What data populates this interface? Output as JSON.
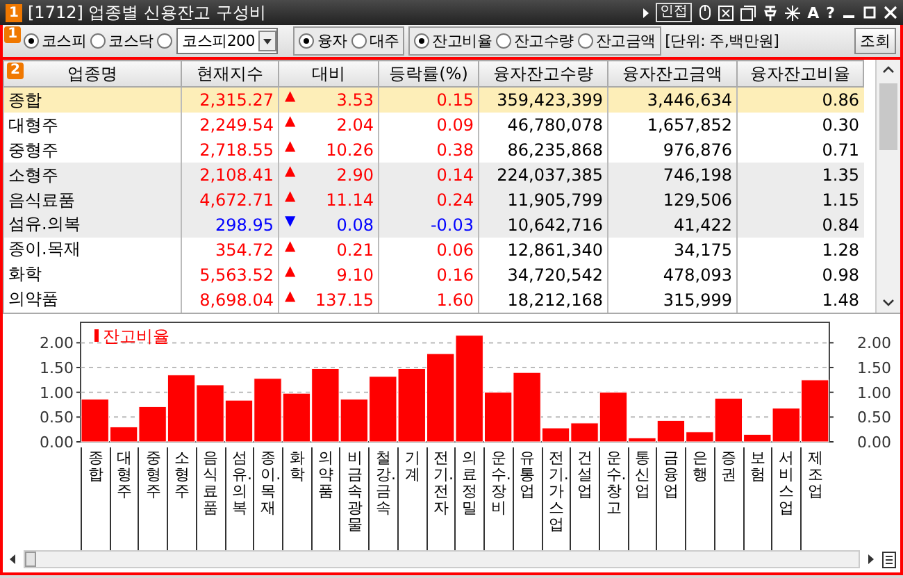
{
  "window": {
    "badge": "1",
    "title": "[1712] 업종별 신용잔고 구성비",
    "link": "인접",
    "tools": [
      "A",
      "?"
    ]
  },
  "toolbar": {
    "badge": "1",
    "market_radios": [
      {
        "label": "코스피",
        "selected": true
      },
      {
        "label": "코스닥",
        "selected": false
      }
    ],
    "index_choice": {
      "selected": false,
      "value": "코스피200"
    },
    "type_radios": [
      {
        "label": "융자",
        "selected": true
      },
      {
        "label": "대주",
        "selected": false
      }
    ],
    "measure_radios": [
      {
        "label": "잔고비율",
        "selected": true
      },
      {
        "label": "잔고수량",
        "selected": false
      },
      {
        "label": "잔고금액",
        "selected": false
      }
    ],
    "unit": "[단위: 주,백만원]",
    "button": "조회"
  },
  "table": {
    "badge": "2",
    "columns": [
      "업종명",
      "현재지수",
      "대비",
      "등락률(%)",
      "융자잔고수량",
      "융자잔고금액",
      "융자잔고비율"
    ],
    "rows": [
      {
        "name": "종합",
        "index": "2,315.27",
        "arrow": "▲",
        "falling": false,
        "change": "3.53",
        "rate": "0.15",
        "quantity": "359,423,399",
        "amount": "3,446,634",
        "ratio": "0.86",
        "selected": true
      },
      {
        "name": "대형주",
        "index": "2,249.54",
        "arrow": "▲",
        "falling": false,
        "change": "2.04",
        "rate": "0.09",
        "quantity": "46,780,078",
        "amount": "1,657,852",
        "ratio": "0.30",
        "selected": false
      },
      {
        "name": "중형주",
        "index": "2,718.55",
        "arrow": "▲",
        "falling": false,
        "change": "10.26",
        "rate": "0.38",
        "quantity": "86,235,868",
        "amount": "976,876",
        "ratio": "0.71",
        "selected": false
      },
      {
        "name": "소형주",
        "index": "2,108.41",
        "arrow": "▲",
        "falling": false,
        "change": "2.90",
        "rate": "0.14",
        "quantity": "224,037,385",
        "amount": "746,198",
        "ratio": "1.35",
        "selected": false
      },
      {
        "name": "음식료품",
        "index": "4,672.71",
        "arrow": "▲",
        "falling": false,
        "change": "11.14",
        "rate": "0.24",
        "quantity": "11,905,799",
        "amount": "129,506",
        "ratio": "1.15",
        "selected": false
      },
      {
        "name": "섬유.의복",
        "index": "298.95",
        "arrow": "▼",
        "falling": true,
        "change": "0.08",
        "rate": "-0.03",
        "quantity": "10,642,716",
        "amount": "41,422",
        "ratio": "0.84",
        "selected": false
      },
      {
        "name": "종이.목재",
        "index": "354.72",
        "arrow": "▲",
        "falling": false,
        "change": "0.21",
        "rate": "0.06",
        "quantity": "12,861,340",
        "amount": "34,175",
        "ratio": "1.28",
        "selected": false
      },
      {
        "name": "화학",
        "index": "5,563.52",
        "arrow": "▲",
        "falling": false,
        "change": "9.10",
        "rate": "0.16",
        "quantity": "34,720,542",
        "amount": "478,093",
        "ratio": "0.98",
        "selected": false
      },
      {
        "name": "의약품",
        "index": "8,698.04",
        "arrow": "▲",
        "falling": false,
        "change": "137.15",
        "rate": "1.60",
        "quantity": "18,212,168",
        "amount": "315,999",
        "ratio": "1.48",
        "selected": false
      }
    ]
  },
  "chart": {
    "chart_data": {
      "type": "bar",
      "categories": [
        "종합",
        "대형주",
        "중형주",
        "소형주",
        "음식료품",
        "섬유.의복",
        "종이.목재",
        "화학",
        "의약품",
        "비금속광물",
        "철강.금속",
        "기계",
        "전기.전자",
        "의료정밀",
        "운수.장비",
        "유통업",
        "전기.가스업",
        "건설업",
        "운수.창고",
        "통신업",
        "금융업",
        "은행",
        "증권",
        "보험",
        "서비스업",
        "제조업"
      ],
      "series": [
        {
          "name": "잔고비율",
          "color": "#ff0000",
          "values": [
            0.86,
            0.3,
            0.71,
            1.35,
            1.15,
            0.84,
            1.28,
            0.98,
            1.48,
            0.86,
            1.32,
            1.48,
            1.78,
            2.15,
            1.0,
            1.4,
            0.28,
            0.38,
            1.0,
            0.08,
            0.43,
            0.2,
            0.88,
            0.15,
            0.68,
            1.25
          ]
        }
      ],
      "ylim": [
        0,
        2.3
      ],
      "grid": true,
      "yticks": [
        {
          "value": 0,
          "label": "0.00"
        },
        {
          "value": 0.5,
          "label": "0.50"
        },
        {
          "value": 1,
          "label": "1.00"
        },
        {
          "value": 1.5,
          "label": "1.50"
        },
        {
          "value": 2,
          "label": "2.00"
        }
      ]
    }
  }
}
